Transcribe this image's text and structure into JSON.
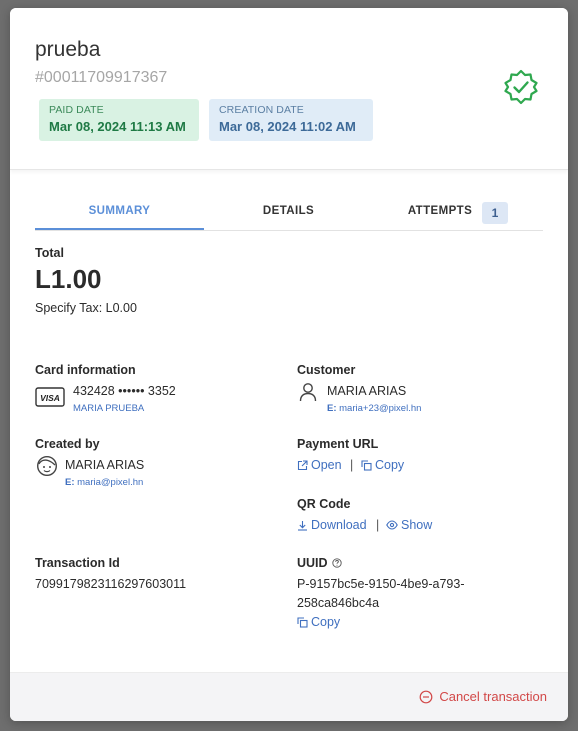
{
  "header": {
    "title": "prueba",
    "transaction_number": "#00011709917367",
    "paid_date": {
      "label": "PAID DATE",
      "value": "Mar 08, 2024 11:13 AM"
    },
    "creation_date": {
      "label": "CREATION DATE",
      "value": "Mar 08, 2024 11:02 AM"
    },
    "status_icon": "verified-badge-icon",
    "status_color": "#2fa84f"
  },
  "tabs": {
    "summary": "SUMMARY",
    "details": "DETAILS",
    "attempts": "ATTEMPTS",
    "attempts_count": "1"
  },
  "summary": {
    "total_label": "Total",
    "total_value": "L1.00",
    "tax_text": "Specify Tax: L0.00"
  },
  "card": {
    "label": "Card information",
    "brand": "VISA",
    "number": "432428 •••••• 3352",
    "holder": "MARIA PRUEBA"
  },
  "customer": {
    "label": "Customer",
    "name": "MARIA ARIAS",
    "email_prefix": "E:",
    "email": "maria+23@pixel.hn"
  },
  "created_by": {
    "label": "Created by",
    "name": "MARIA ARIAS",
    "email_prefix": "E:",
    "email": "maria@pixel.hn"
  },
  "payment_url": {
    "label": "Payment URL",
    "open": "Open",
    "separator": "|",
    "copy": "Copy"
  },
  "qr_code": {
    "label": "QR Code",
    "download": "Download",
    "separator": "|",
    "show": "Show"
  },
  "transaction_id": {
    "label": "Transaction Id",
    "value": "709917982311629760301​1"
  },
  "uuid": {
    "label": "UUID",
    "value_line1": "P-9157bc5e-9150-4be9-a793-",
    "value_line2": "258ca846bc4a",
    "copy": "Copy"
  },
  "footer": {
    "cancel": "Cancel transaction",
    "cancel_color": "#d24848"
  },
  "colors": {
    "accent": "#5b8fd8",
    "link": "#3f6fbf"
  }
}
